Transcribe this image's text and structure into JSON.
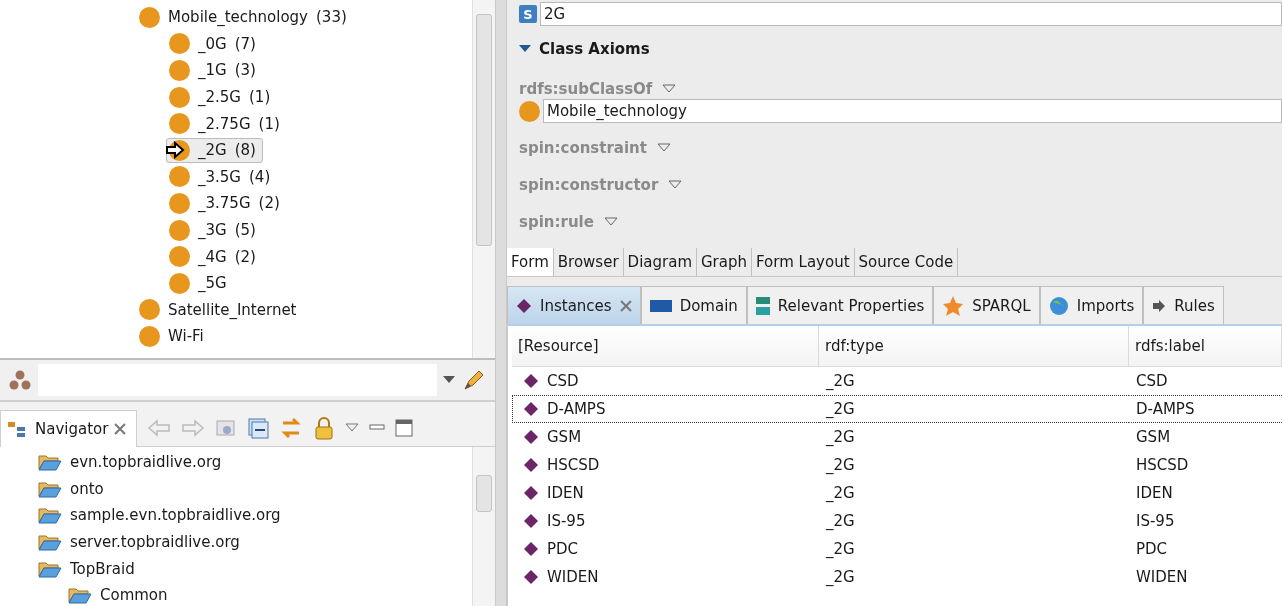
{
  "class_tree": {
    "items": [
      {
        "label": "Mobile_technology",
        "count": "(33)",
        "selected": false,
        "children": [
          {
            "label": "_0G",
            "count": "(7)",
            "selected": false
          },
          {
            "label": "_1G",
            "count": "(3)",
            "selected": false
          },
          {
            "label": "_2.5G",
            "count": "(1)",
            "selected": false
          },
          {
            "label": "_2.75G",
            "count": "(1)",
            "selected": false
          },
          {
            "label": "_2G",
            "count": "(8)",
            "selected": true
          },
          {
            "label": "_3.5G",
            "count": "(4)",
            "selected": false
          },
          {
            "label": "_3.75G",
            "count": "(2)",
            "selected": false
          },
          {
            "label": "_3G",
            "count": "(5)",
            "selected": false
          },
          {
            "label": "_4G",
            "count": "(2)",
            "selected": false
          },
          {
            "label": "_5G",
            "selected": false
          }
        ]
      },
      {
        "label": "Satellite_Internet",
        "selected": false
      },
      {
        "label": "Wi-Fi",
        "selected": false
      }
    ]
  },
  "navigator": {
    "tab": "Navigator",
    "items": [
      {
        "label": "evn.topbraidlive.org"
      },
      {
        "label": "onto"
      },
      {
        "label": "sample.evn.topbraidlive.org"
      },
      {
        "label": "server.topbraidlive.org"
      },
      {
        "label": "TopBraid",
        "children": [
          {
            "label": "Common"
          }
        ]
      }
    ]
  },
  "form": {
    "type_badge": "S",
    "label_field": "2G",
    "section": "Class Axioms",
    "properties": [
      {
        "name": "rdfs:subClassOf",
        "values": [
          "Mobile_technology"
        ]
      },
      {
        "name": "spin:constraint"
      },
      {
        "name": "spin:constructor"
      },
      {
        "name": "spin:rule"
      }
    ]
  },
  "editor_tabs": [
    {
      "label": "Form",
      "selected": true
    },
    {
      "label": "Browser",
      "selected": false
    },
    {
      "label": "Diagram",
      "selected": false
    },
    {
      "label": "Graph",
      "selected": false
    },
    {
      "label": "Form Layout",
      "selected": false
    },
    {
      "label": "Source Code",
      "selected": false
    }
  ],
  "view_tabs": [
    {
      "label": "Instances",
      "kind": "instances",
      "selected": true
    },
    {
      "label": "Domain",
      "kind": "domain",
      "selected": false
    },
    {
      "label": "Relevant Properties",
      "kind": "properties",
      "selected": false
    },
    {
      "label": "SPARQL",
      "kind": "sparql",
      "selected": false
    },
    {
      "label": "Imports",
      "kind": "imports",
      "selected": false
    },
    {
      "label": "Rules",
      "kind": "rules",
      "selected": false
    }
  ],
  "table": {
    "columns": [
      "[Resource]",
      "rdf:type",
      "rdfs:label"
    ],
    "rows": [
      {
        "cells": [
          "CSD",
          "_2G",
          "CSD"
        ],
        "selected": false
      },
      {
        "cells": [
          "D-AMPS",
          "_2G",
          "D-AMPS"
        ],
        "selected": true
      },
      {
        "cells": [
          "GSM",
          "_2G",
          "GSM"
        ],
        "selected": false
      },
      {
        "cells": [
          "HSCSD",
          "_2G",
          "HSCSD"
        ],
        "selected": false
      },
      {
        "cells": [
          "IDEN",
          "_2G",
          "IDEN"
        ],
        "selected": false
      },
      {
        "cells": [
          "IS-95",
          "_2G",
          "IS-95"
        ],
        "selected": false
      },
      {
        "cells": [
          "PDC",
          "_2G",
          "PDC"
        ],
        "selected": false
      },
      {
        "cells": [
          "WIDEN",
          "_2G",
          "WIDEN"
        ],
        "selected": false
      }
    ]
  }
}
